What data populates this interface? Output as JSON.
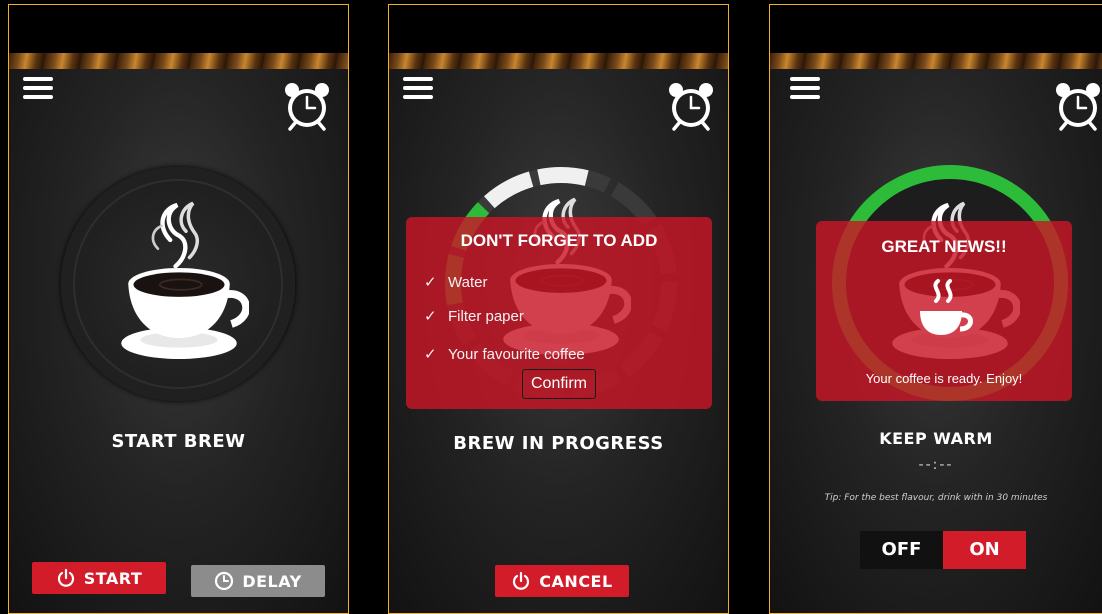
{
  "screens": [
    {
      "label": "START BREW",
      "buttons": {
        "start": "START",
        "delay": "DELAY"
      }
    },
    {
      "label": "BREW IN PROGRESS",
      "dialog": {
        "title": "DON'T FORGET TO ADD",
        "items": [
          "Water",
          "Filter paper",
          "Your favourite coffee"
        ],
        "confirm": "Confirm"
      },
      "buttons": {
        "cancel": "CANCEL"
      }
    },
    {
      "label": "KEEP WARM",
      "timer": "--:--",
      "tip": "Tip: For the best flavour, drink with in 30 minutes",
      "dialog": {
        "title": "GREAT NEWS!!",
        "message": "Your coffee is ready. Enjoy!"
      },
      "toggle": {
        "off": "OFF",
        "on": "ON",
        "selected": "ON"
      }
    }
  ],
  "icons": [
    "menu-icon",
    "alarm-clock-icon",
    "coffee-cup-icon",
    "power-icon",
    "clock-icon"
  ],
  "colors": {
    "accent_red": "#d31c2a",
    "progress_green": "#2dbb3a",
    "frame_gold": "#f2b124",
    "delay_gray": "#8c8c8c"
  }
}
